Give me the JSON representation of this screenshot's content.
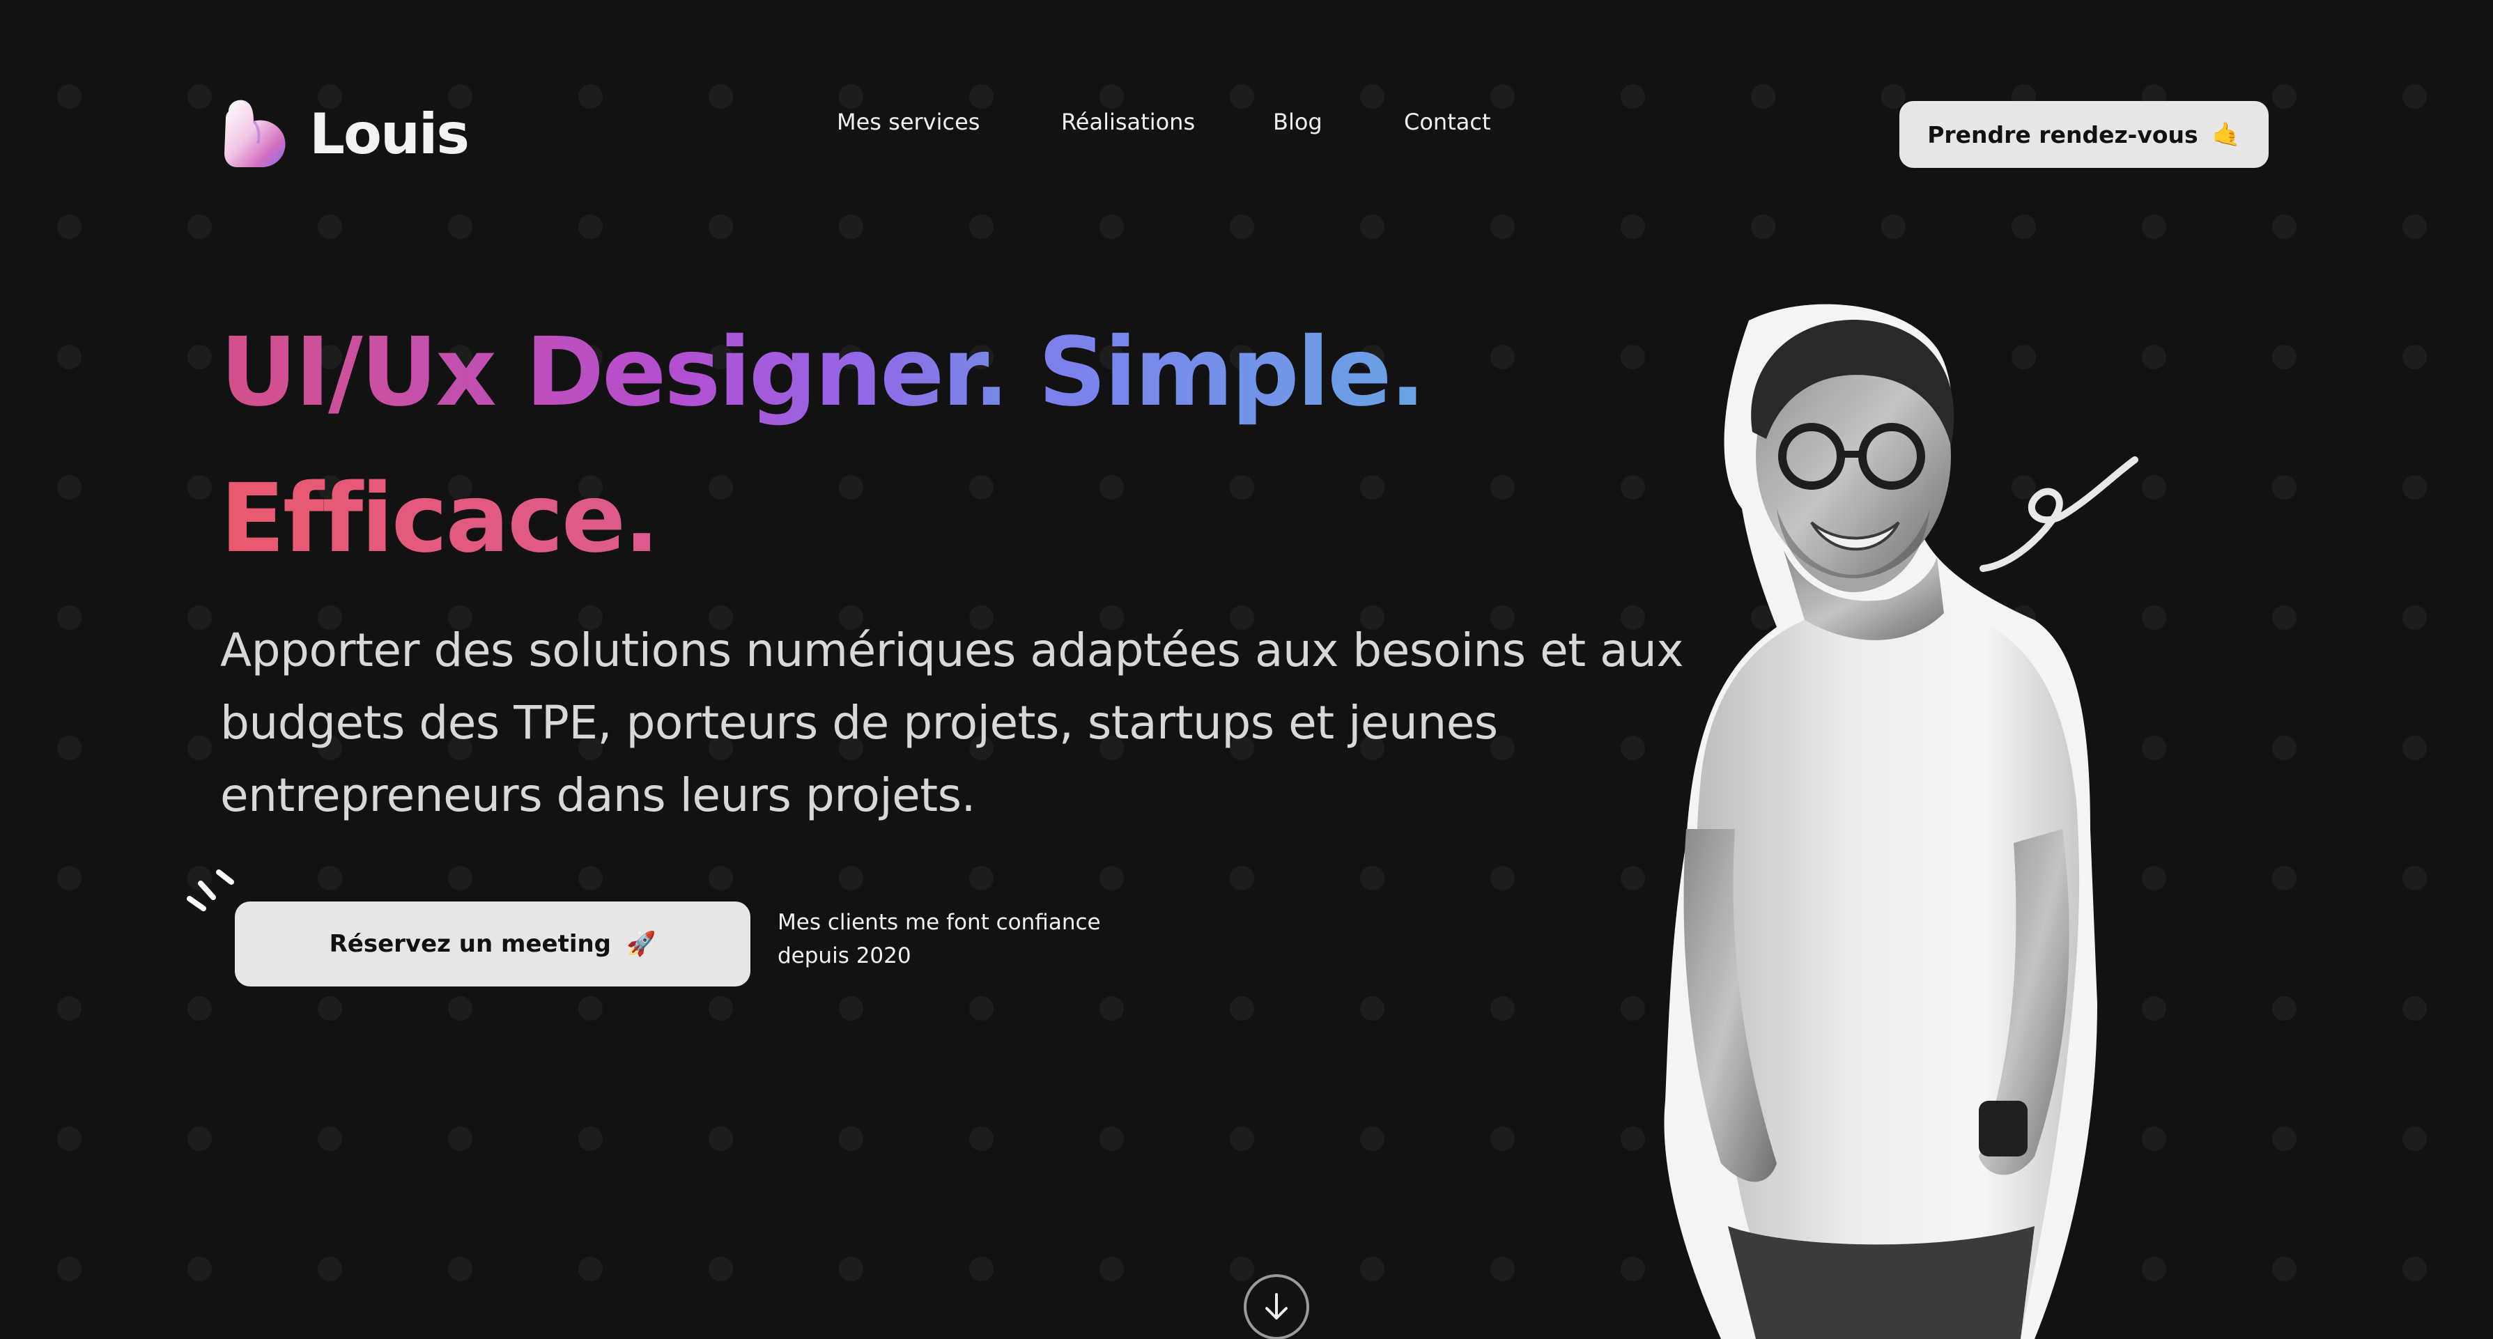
{
  "header": {
    "brand": "Louis",
    "nav": [
      {
        "label": "Mes services"
      },
      {
        "label": "Réalisations"
      },
      {
        "label": "Blog"
      },
      {
        "label": "Contact"
      }
    ],
    "cta_label": "Prendre rendez-vous",
    "cta_emoji": "🤙"
  },
  "hero": {
    "headline_part1": "UI/Ux Designer. ",
    "headline_part2": "Simple. ",
    "headline_part3": "Efficace.",
    "subtitle": "Apporter des solutions numériques adaptées aux besoins et aux budgets des TPE, porteurs de projets, startups et jeunes entrepreneurs dans leurs projets.",
    "cta_label": "Réservez un meeting",
    "cta_emoji": "🚀",
    "trust_text": "Mes clients me font confiance depuis 2020"
  },
  "icons": {
    "logo": "logo-mark-icon",
    "scroll": "arrow-down-icon",
    "decoration_left": "sparkle-lines-icon",
    "decoration_right": "scribble-icon"
  },
  "colors": {
    "background": "#121212",
    "button_bg": "#e6e6e6",
    "gradient_pink": "#d4508a",
    "gradient_purple": "#b54fd0",
    "gradient_blue": "#6aa4e4",
    "gradient_red": "#ea5a6e"
  }
}
